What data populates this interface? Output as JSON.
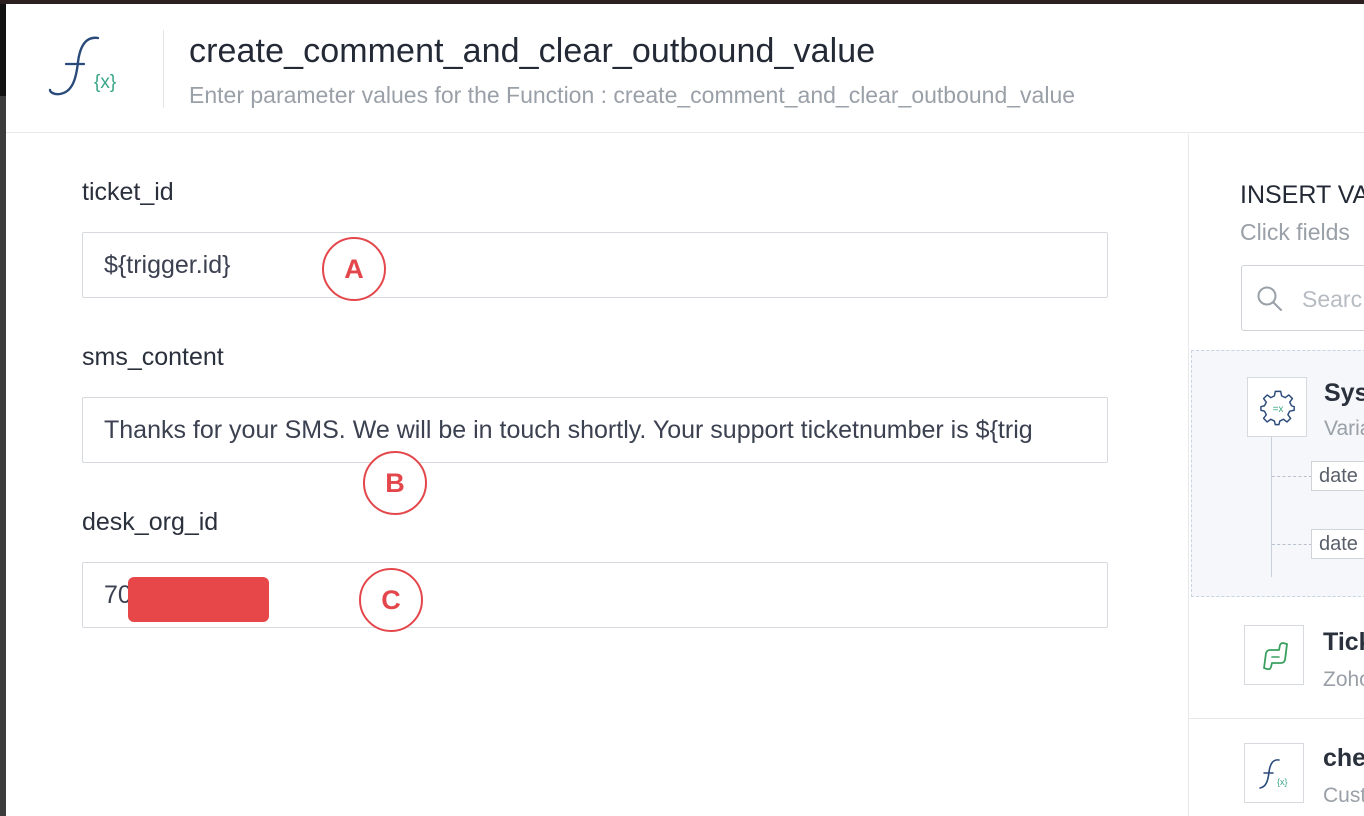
{
  "dialog": {
    "title": "create_comment_and_clear_outbound_value",
    "subtitle": "Enter parameter values for the Function : create_comment_and_clear_outbound_value"
  },
  "fields": [
    {
      "label": "ticket_id",
      "value": "${trigger.id}",
      "marker": "A"
    },
    {
      "label": "sms_content",
      "value": "Thanks for your SMS. We will be in touch shortly. Your support ticketnumber is ${trig",
      "marker": "B"
    },
    {
      "label": "desk_org_id",
      "value": "70",
      "marker": "C"
    }
  ],
  "insert_panel": {
    "title": "INSERT VA",
    "hint": "Click fields",
    "search_placeholder": "Searc",
    "items": [
      {
        "title": "Syst",
        "subtitle": "Varia",
        "icon": "system-variables-gear-icon",
        "children": [
          "date",
          "date"
        ]
      },
      {
        "title": "Tick",
        "subtitle": "Zoho",
        "icon": "zoho-desk-ticket-icon"
      },
      {
        "title": "che",
        "subtitle": "Cust",
        "icon": "function-fx-icon"
      }
    ]
  },
  "colors": {
    "marker_red": "#e4474b",
    "redaction_red": "#e8474a",
    "function_icon_blue": "#2a4a7a",
    "function_icon_teal": "#3aa689"
  }
}
